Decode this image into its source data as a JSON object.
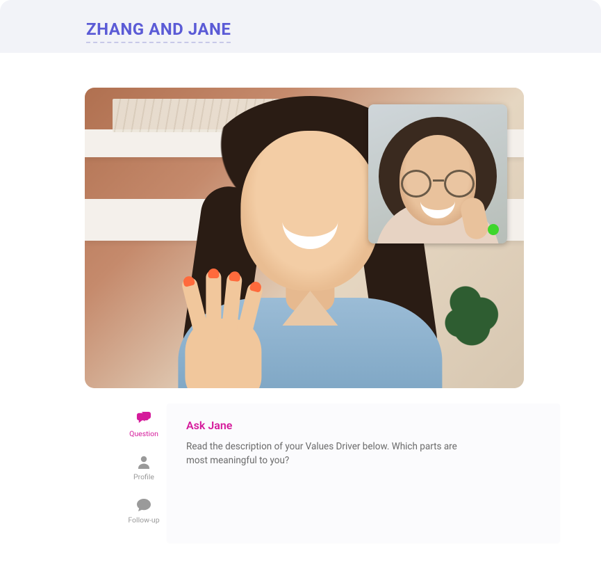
{
  "header": {
    "title": "ZHANG AND JANE"
  },
  "video": {
    "main_participant": "Zhang",
    "pip_participant": "Jane",
    "pip_status_color": "#3dd62c"
  },
  "tabs": [
    {
      "id": "question",
      "label": "Question",
      "icon": "chat-bubbles-icon",
      "active": true
    },
    {
      "id": "profile",
      "label": "Profile",
      "icon": "user-icon",
      "active": false
    },
    {
      "id": "followup",
      "label": "Follow-up",
      "icon": "chat-ellipsis-icon",
      "active": false
    }
  ],
  "card": {
    "title": "Ask Jane",
    "body": "Read the description of your Values Driver below. Which parts are most meaningful to you?"
  },
  "colors": {
    "title": "#5b5bd6",
    "accent": "#d51a9b",
    "header_bg": "#f2f3f8",
    "card_bg": "#fbfbfd"
  }
}
